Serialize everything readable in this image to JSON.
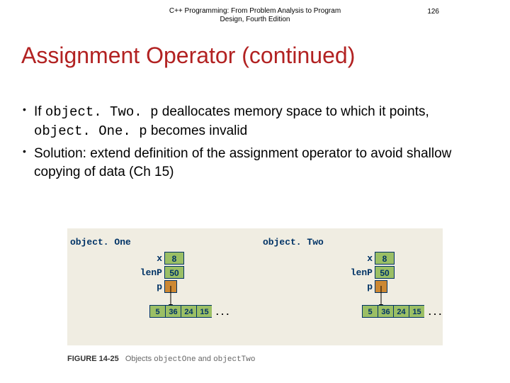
{
  "header": {
    "book_title": "C++ Programming: From Problem Analysis to Program Design, Fourth Edition",
    "page_number": "126"
  },
  "title": "Assignment Operator (continued)",
  "bullets": [
    {
      "prefix": "If ",
      "code1": "object. Two. p",
      "mid1": " deallocates memory space to which it points, ",
      "code2": "object. One. p",
      "suffix": " becomes invalid"
    },
    {
      "text": "Solution: extend definition of the assignment operator to avoid shallow copying of data (Ch 15)"
    }
  ],
  "figure": {
    "obj1_label": "object. One",
    "obj2_label": "object. Two",
    "rows": {
      "x": "x",
      "lenP": "lenP",
      "p": "p"
    },
    "obj1": {
      "x": "8",
      "lenP": "50"
    },
    "obj2": {
      "x": "8",
      "lenP": "50"
    },
    "array": [
      "5",
      "36",
      "24",
      "15"
    ],
    "dots": ". . .",
    "caption_num": "FIGURE 14-25",
    "caption_prefix": "Objects ",
    "caption_c1": "objectOne",
    "caption_mid": " and ",
    "caption_c2": "objectTwo"
  }
}
